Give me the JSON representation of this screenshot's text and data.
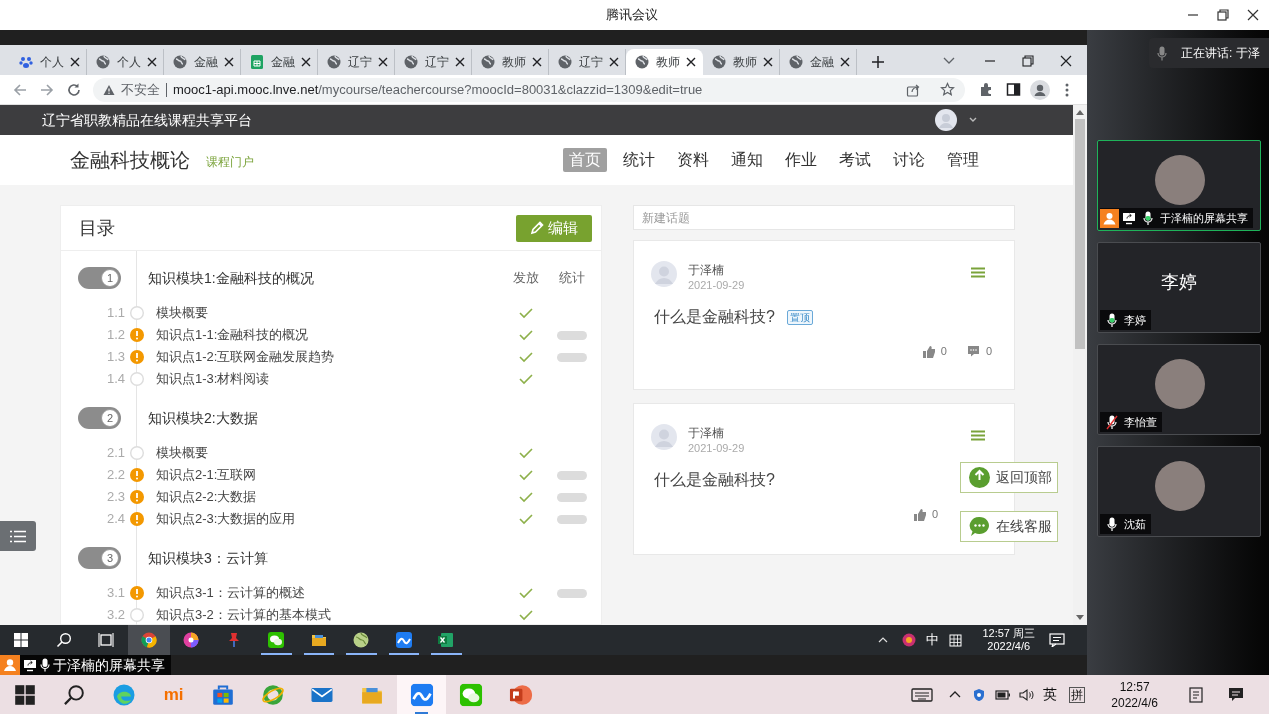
{
  "meeting": {
    "title": "腾讯会议",
    "speaking_label": "正在讲话: 于泽",
    "share_label": "于泽楠的屏幕共享"
  },
  "participants": [
    {
      "kind": "photo",
      "name": "于泽楠的屏幕共享",
      "active": true,
      "host": true,
      "sharing": true,
      "muted": false,
      "speaking": true
    },
    {
      "kind": "name",
      "display_name": "李婷",
      "name": "李婷",
      "active": false,
      "host": false,
      "sharing": false,
      "muted": false,
      "speaking": true
    },
    {
      "kind": "photo",
      "name": "李怡萱",
      "active": false,
      "host": false,
      "sharing": false,
      "muted": true,
      "speaking": false
    },
    {
      "kind": "photo",
      "name": "沈茹",
      "active": false,
      "host": false,
      "sharing": false,
      "muted": false,
      "speaking": false
    }
  ],
  "browser": {
    "tabs": [
      {
        "kind": "paw",
        "label": "个人",
        "selected": false
      },
      {
        "kind": "globe",
        "label": "个人",
        "selected": false
      },
      {
        "kind": "globe",
        "label": "金融",
        "selected": false
      },
      {
        "kind": "sheet",
        "label": "金融",
        "selected": false
      },
      {
        "kind": "globe",
        "label": "辽宁",
        "selected": false
      },
      {
        "kind": "globe",
        "label": "辽宁",
        "selected": false
      },
      {
        "kind": "globe",
        "label": "教师",
        "selected": false
      },
      {
        "kind": "globe",
        "label": "辽宁",
        "selected": false
      },
      {
        "kind": "globe",
        "label": "教师",
        "selected": true
      },
      {
        "kind": "globe",
        "label": "教师",
        "selected": false
      },
      {
        "kind": "globe",
        "label": "金融",
        "selected": false
      }
    ],
    "security_label": "不安全",
    "url_host": "mooc1-api.mooc.lnve.net",
    "url_path": "/mycourse/teachercourse?moocId=80031&clazzid=1309&edit=true"
  },
  "site": {
    "platform": "辽宁省职教精品在线课程共享平台",
    "course_title": "金融科技概论",
    "portal_link": "课程门户",
    "nav": [
      {
        "label": "首页",
        "selected": true
      },
      {
        "label": "统计",
        "selected": false
      },
      {
        "label": "资料",
        "selected": false
      },
      {
        "label": "通知",
        "selected": false
      },
      {
        "label": "作业",
        "selected": false
      },
      {
        "label": "考试",
        "selected": false
      },
      {
        "label": "讨论",
        "selected": false
      },
      {
        "label": "管理",
        "selected": false
      }
    ]
  },
  "catalog": {
    "title": "目录",
    "edit_button": "编辑",
    "column_headers": [
      "发放",
      "统计"
    ],
    "modules": [
      {
        "number": "1",
        "title": "知识模块1:金融科技的概况",
        "children": [
          {
            "index": "1.1",
            "title": "模块概要",
            "pending": false,
            "released": true,
            "stats": false
          },
          {
            "index": "1.2",
            "title": "知识点1-1:金融科技的概况",
            "pending": true,
            "released": true,
            "stats": true
          },
          {
            "index": "1.3",
            "title": "知识点1-2:互联网金融发展趋势",
            "pending": true,
            "released": true,
            "stats": true
          },
          {
            "index": "1.4",
            "title": "知识点1-3:材料阅读",
            "pending": false,
            "released": true,
            "stats": false
          }
        ]
      },
      {
        "number": "2",
        "title": "知识模块2:大数据",
        "children": [
          {
            "index": "2.1",
            "title": "模块概要",
            "pending": false,
            "released": true,
            "stats": false
          },
          {
            "index": "2.2",
            "title": "知识点2-1:互联网",
            "pending": true,
            "released": true,
            "stats": true
          },
          {
            "index": "2.3",
            "title": "知识点2-2:大数据",
            "pending": true,
            "released": true,
            "stats": true
          },
          {
            "index": "2.4",
            "title": "知识点2-3:大数据的应用",
            "pending": true,
            "released": true,
            "stats": true
          }
        ]
      },
      {
        "number": "3",
        "title": "知识模块3：云计算",
        "children": [
          {
            "index": "3.1",
            "title": "知识点3-1：云计算的概述",
            "pending": true,
            "released": true,
            "stats": true
          },
          {
            "index": "3.2",
            "title": "知识点3-2：云计算的基本模式",
            "pending": false,
            "released": true,
            "stats": false
          }
        ]
      }
    ]
  },
  "discussion": {
    "new_topic_placeholder": "新建话题",
    "posts": [
      {
        "author": "于泽楠",
        "date": "2021-09-29",
        "title": "什么是金融科技?",
        "pinned_label": "置顶",
        "likes": "0",
        "comments": "0"
      },
      {
        "author": "于泽楠",
        "date": "2021-09-29",
        "title": "什么是金融科技?",
        "likes": "0"
      }
    ]
  },
  "float_buttons": [
    {
      "kind": "top",
      "label": "返回顶部"
    },
    {
      "kind": "service",
      "label": "在线客服"
    }
  ],
  "remote_taskbar": {
    "apps": [
      {
        "kind": "windows",
        "active": false,
        "running": false
      },
      {
        "kind": "search",
        "active": false,
        "running": false
      },
      {
        "kind": "taskview",
        "active": false,
        "running": false
      },
      {
        "kind": "chrome",
        "active": true,
        "running": false
      },
      {
        "kind": "colorwheel",
        "active": false,
        "running": false
      },
      {
        "kind": "pin",
        "active": false,
        "running": false
      },
      {
        "kind": "wechat",
        "active": false,
        "running": true
      },
      {
        "kind": "folder",
        "active": false,
        "running": true
      },
      {
        "kind": "globe",
        "active": false,
        "running": true
      },
      {
        "kind": "lark",
        "active": false,
        "running": true
      },
      {
        "kind": "excel",
        "active": false,
        "running": true
      }
    ],
    "ime": "中",
    "time": "12:57 周三",
    "date": "2022/4/6"
  },
  "local_taskbar": {
    "apps": [
      {
        "kind": "windows",
        "active": false
      },
      {
        "kind": "search",
        "active": false
      },
      {
        "kind": "edge",
        "active": false
      },
      {
        "kind": "mi",
        "label": "mi",
        "active": false
      },
      {
        "kind": "store",
        "active": false
      },
      {
        "kind": "ie",
        "active": false
      },
      {
        "kind": "mail",
        "active": false
      },
      {
        "kind": "folder",
        "active": false
      },
      {
        "kind": "lark",
        "active": true
      },
      {
        "kind": "wechat",
        "active": false
      },
      {
        "kind": "powerpoint",
        "active": false
      }
    ],
    "lang": "英",
    "ime": "拼",
    "time": "12:57",
    "date": "2022/4/6"
  }
}
